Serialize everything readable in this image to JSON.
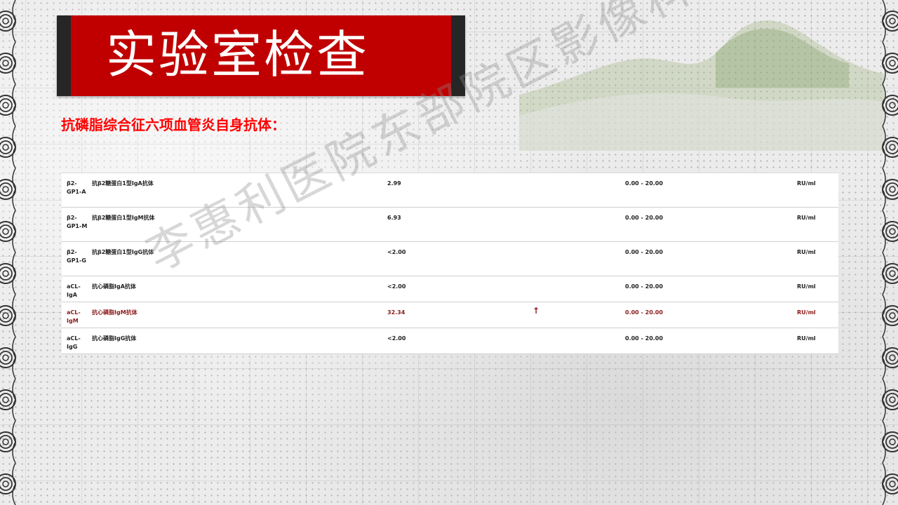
{
  "title": "实验室检查",
  "subtitle": "抗磷脂综合征六项血管炎自身抗体：",
  "watermark": "李惠利医院东部院区影像科",
  "colors": {
    "title_bar": "#c00000",
    "subtitle": "#ff0000",
    "abnormal": "#8b1a1a"
  },
  "table": {
    "rows": [
      {
        "code": "β2-GP1-A",
        "name": "抗β2糖蛋白1型IgA抗体",
        "value": "2.99",
        "flag": "",
        "range": "0.00 - 20.00",
        "unit": "RU/ml"
      },
      {
        "code": "β2-GP1-M",
        "name": "抗β2糖蛋白1型IgM抗体",
        "value": "6.93",
        "flag": "",
        "range": "0.00 - 20.00",
        "unit": "RU/ml"
      },
      {
        "code": "β2-GP1-G",
        "name": "抗β2糖蛋白1型IgG抗体",
        "value": "<2.00",
        "flag": "",
        "range": "0.00 - 20.00",
        "unit": "RU/ml"
      },
      {
        "code": "aCL-IgA",
        "name": "抗心磷脂IgA抗体",
        "value": "<2.00",
        "flag": "",
        "range": "0.00 - 20.00",
        "unit": "RU/ml"
      },
      {
        "code": "aCL-IgM",
        "name": "抗心磷脂IgM抗体",
        "value": "32.34",
        "flag": "↑",
        "range": "0.00 - 20.00",
        "unit": "RU/ml"
      },
      {
        "code": "aCL-IgG",
        "name": "抗心磷脂IgG抗体",
        "value": "<2.00",
        "flag": "",
        "range": "0.00 - 20.00",
        "unit": "RU/ml"
      }
    ]
  }
}
